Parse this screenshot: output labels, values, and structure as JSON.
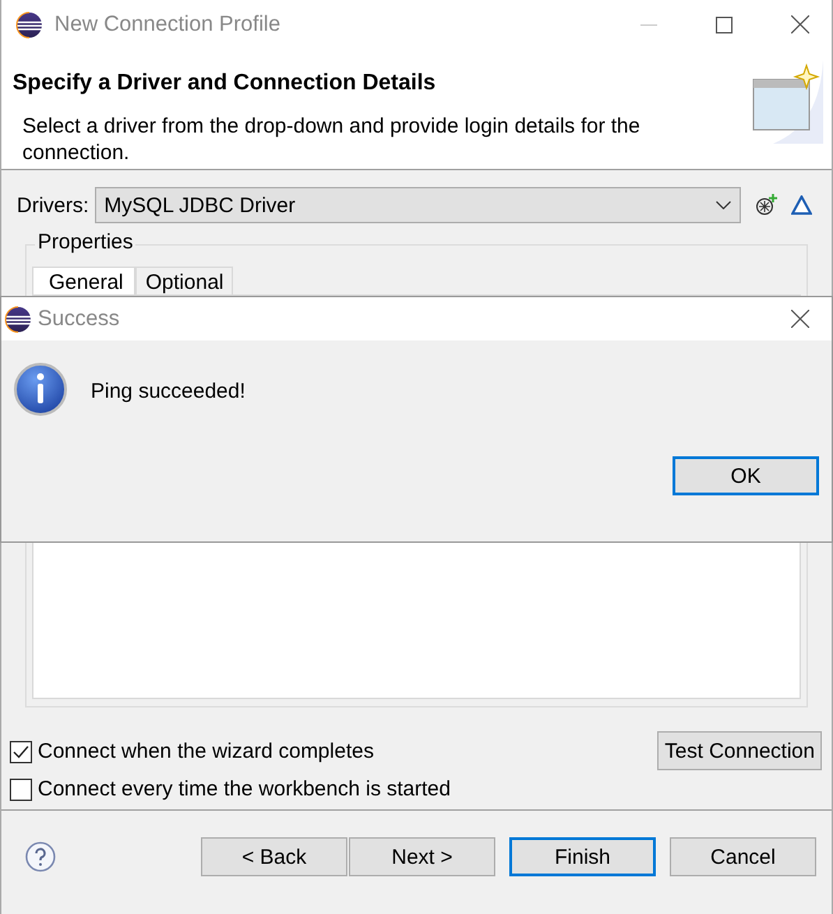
{
  "window": {
    "title": "New Connection Profile"
  },
  "header": {
    "title": "Specify a Driver and Connection Details",
    "description": "Select a driver from the drop-down and provide login details for the connection."
  },
  "drivers": {
    "label": "Drivers:",
    "value": "MySQL JDBC Driver"
  },
  "properties": {
    "label": "Properties",
    "tabs": [
      {
        "label": "General",
        "selected": true
      },
      {
        "label": "Optional",
        "selected": false
      }
    ]
  },
  "options": [
    {
      "label": "Connect when the wizard completes",
      "checked": true
    },
    {
      "label": "Connect every time the workbench is started",
      "checked": false
    }
  ],
  "test_button": "Test Connection",
  "buttons": [
    {
      "label": "< Back",
      "default": false
    },
    {
      "label": "Next >",
      "default": false
    },
    {
      "label": "Finish",
      "default": true
    },
    {
      "label": "Cancel",
      "default": false
    }
  ],
  "dialog": {
    "title": "Success",
    "message": "Ping succeeded!",
    "button": "OK"
  }
}
